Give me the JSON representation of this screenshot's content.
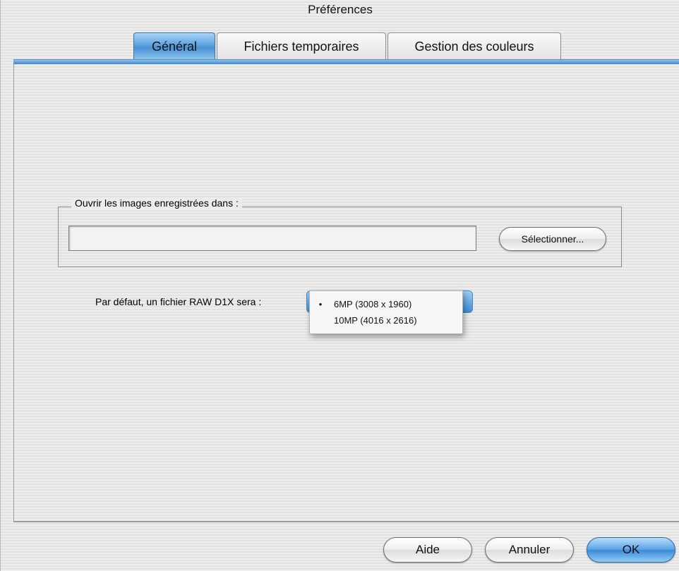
{
  "window": {
    "title": "Préférences"
  },
  "tabs": [
    {
      "label": "Général",
      "active": true
    },
    {
      "label": "Fichiers temporaires",
      "active": false
    },
    {
      "label": "Gestion des couleurs",
      "active": false
    }
  ],
  "open_folder": {
    "group_label": "Ouvrir les images enregistrées dans :",
    "path_value": "",
    "select_button": "Sélectionner..."
  },
  "raw_default": {
    "label": "Par défaut, un fichier RAW D1X sera :",
    "options": [
      {
        "label": "6MP (3008 x 1960)",
        "selected": true,
        "check": "•"
      },
      {
        "label": "10MP (4016 x 2616)",
        "selected": false,
        "check": ""
      }
    ]
  },
  "footer": {
    "help_button": "Aide",
    "cancel_button": "Annuler",
    "ok_button": "OK"
  },
  "colors": {
    "accent": "#4a92d4"
  }
}
